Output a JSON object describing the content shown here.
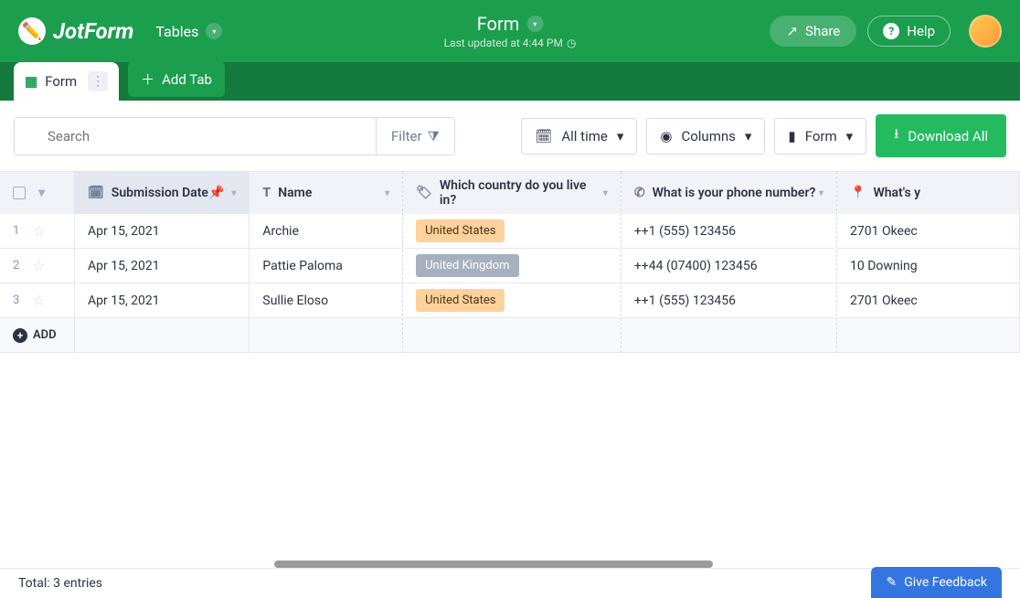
{
  "header": {
    "logo_text": "JotForm",
    "tables_label": "Tables",
    "form_title": "Form",
    "last_updated": "Last updated at 4:44 PM",
    "share_label": "Share",
    "help_label": "Help"
  },
  "tabs": {
    "form_tab": "Form",
    "add_tab": "Add Tab"
  },
  "toolbar": {
    "search_placeholder": "Search",
    "filter_label": "Filter",
    "all_time": "All time",
    "columns": "Columns",
    "form": "Form",
    "download": "Download All"
  },
  "columns": {
    "submission_date": "Submission Date",
    "name": "Name",
    "country": "Which country do you live in?",
    "phone": "What is your phone number?",
    "address": "What's y"
  },
  "rows": [
    {
      "idx": "1",
      "date": "Apr 15, 2021",
      "name": "Archie",
      "country": "United States",
      "country_class": "us",
      "phone": "++1 (555) 123456",
      "address": "2701 Okeec"
    },
    {
      "idx": "2",
      "date": "Apr 15, 2021",
      "name": "Pattie Paloma",
      "country": "United Kingdom",
      "country_class": "uk",
      "phone": "++44 (07400) 123456",
      "address": "10 Downing"
    },
    {
      "idx": "3",
      "date": "Apr 15, 2021",
      "name": "Sullie Eloso",
      "country": "United States",
      "country_class": "us",
      "phone": "++1 (555) 123456",
      "address": "2701 Okeec"
    }
  ],
  "add_row": "ADD",
  "footer": {
    "total": "Total: 3 entries",
    "feedback": "Give Feedback"
  }
}
